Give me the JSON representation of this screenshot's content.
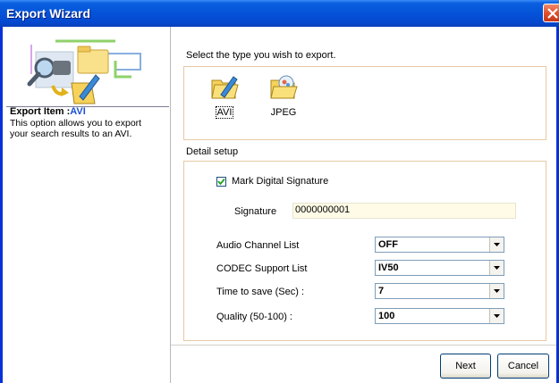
{
  "window": {
    "title": "Export Wizard",
    "close_icon": "close-icon"
  },
  "sidebar": {
    "export_item_label": "Export Item :",
    "export_item_value": "AVI",
    "description": "This option allows you to export your search results to an AVI."
  },
  "main": {
    "prompt": "Select the type you wish to export.",
    "types": [
      {
        "label": "AVI",
        "icon": "avi-folder-icon",
        "selected": true
      },
      {
        "label": "JPEG",
        "icon": "jpeg-folder-icon",
        "selected": false
      }
    ],
    "detail_title": "Detail setup",
    "mark_signature_label": "Mark Digital Signature",
    "mark_signature_checked": true,
    "signature_label": "Signature",
    "signature_value": "0000000001",
    "fields": [
      {
        "label": "Audio Channel List",
        "value": "OFF"
      },
      {
        "label": "CODEC Support List",
        "value": "IV50"
      },
      {
        "label": "Time to save (Sec) :",
        "value": "7"
      },
      {
        "label": "Quality (50-100) :",
        "value": "100"
      }
    ]
  },
  "buttons": {
    "next": "Next",
    "cancel": "Cancel"
  },
  "colors": {
    "title_bar": "#0553d8",
    "accent_value": "#1b4fd6",
    "group_border": "#e7c9a4",
    "signature_bg": "#fffbe6"
  }
}
